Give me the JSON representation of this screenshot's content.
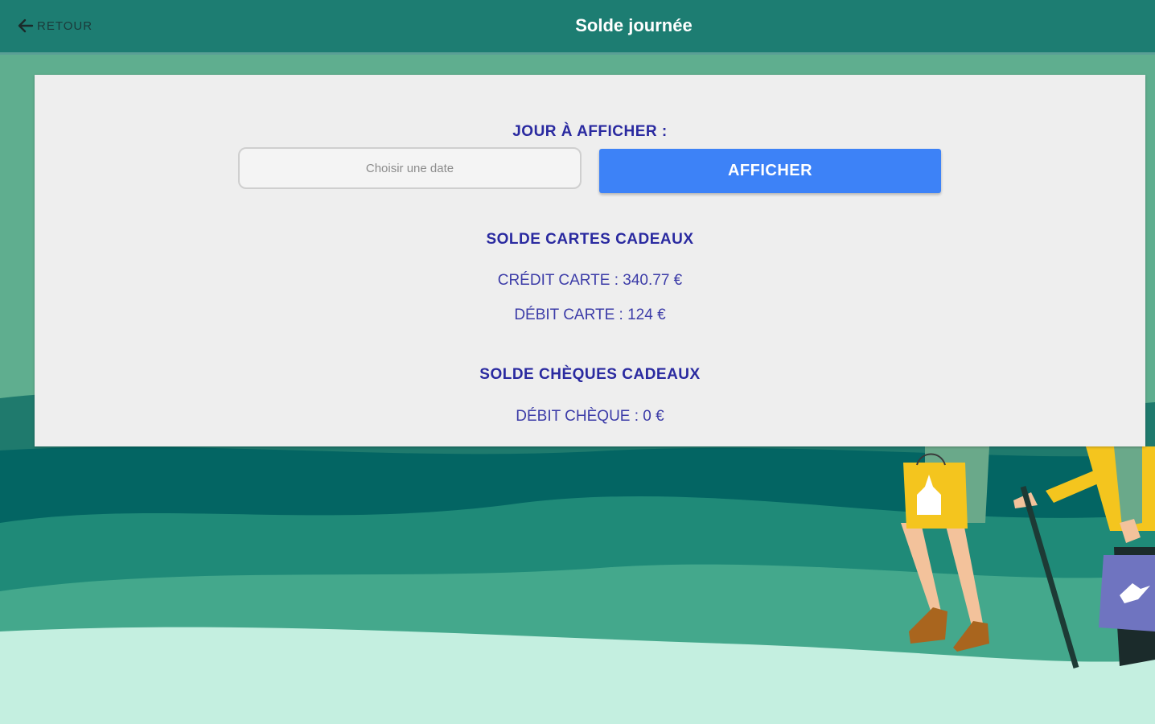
{
  "header": {
    "back_label": "RETOUR",
    "title": "Solde journée"
  },
  "form": {
    "day_label": "JOUR À AFFICHER :",
    "date_placeholder": "Choisir une date",
    "submit_label": "AFFICHER"
  },
  "gift_cards": {
    "heading": "SOLDE CARTES CADEAUX",
    "credit": "CRÉDIT CARTE : 340.77 €",
    "debit": "DÉBIT CARTE : 124 €"
  },
  "gift_cheques": {
    "heading": "SOLDE CHÈQUES CADEAUX",
    "debit": "DÉBIT CHÈQUE : 0 €"
  },
  "colors": {
    "header_bg": "#1d7d72",
    "accent_button": "#3d82f7",
    "text_primary": "#2a2aa0",
    "card_bg": "#eeeeee"
  }
}
